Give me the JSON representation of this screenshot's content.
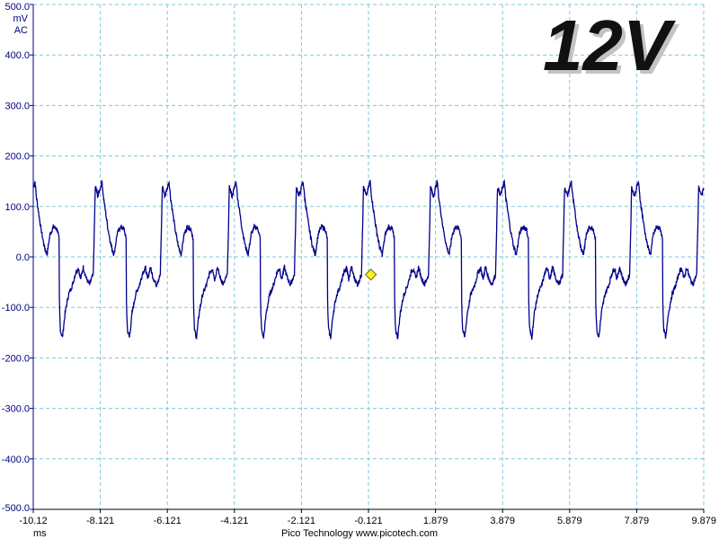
{
  "chart_data": {
    "type": "line",
    "y_unit": "mV",
    "coupling": "AC",
    "x_unit": "ms",
    "annotation": "12V",
    "credit": "Pico Technology  www.picotech.com",
    "grid": true,
    "xlim": [
      -10.121,
      9.879
    ],
    "ylim": [
      -500,
      500
    ],
    "y_ticks": [
      500,
      400,
      300,
      200,
      100,
      0,
      -100,
      -200,
      -300,
      -400,
      -500
    ],
    "y_tick_labels": [
      "500.0",
      "400.0",
      "300.0",
      "200.0",
      "100.0",
      "0.0",
      "-100.0",
      "-200.0",
      "-300.0",
      "-400.0",
      "-500.0"
    ],
    "x_ticks": [
      -10.121,
      -8.121,
      -6.121,
      -4.121,
      -2.121,
      -0.121,
      1.879,
      3.879,
      5.879,
      7.879,
      9.879
    ],
    "x_tick_labels": [
      "-10.12",
      "-8.121",
      "-6.121",
      "-4.121",
      "-2.121",
      "-0.121",
      "1.879",
      "3.879",
      "5.879",
      "7.879",
      "9.879"
    ],
    "trigger_marker": {
      "x": -0.05,
      "y": -35
    },
    "period_ms": 2.0,
    "cycle_start_ms": -10.07,
    "cycle_shape": [
      [
        0.0,
        150
      ],
      [
        0.04,
        120
      ],
      [
        0.18,
        55
      ],
      [
        0.28,
        20
      ],
      [
        0.36,
        5
      ],
      [
        0.45,
        45
      ],
      [
        0.55,
        60
      ],
      [
        0.66,
        55
      ],
      [
        0.72,
        35
      ],
      [
        0.73,
        -100
      ],
      [
        0.76,
        -145
      ],
      [
        0.82,
        -160
      ],
      [
        0.9,
        -110
      ],
      [
        1.0,
        -75
      ],
      [
        1.12,
        -55
      ],
      [
        1.22,
        -30
      ],
      [
        1.3,
        -22
      ],
      [
        1.36,
        -45
      ],
      [
        1.44,
        -20
      ],
      [
        1.52,
        -40
      ],
      [
        1.62,
        -55
      ],
      [
        1.74,
        -35
      ],
      [
        1.8,
        140
      ],
      [
        1.88,
        120
      ],
      [
        2.0,
        150
      ]
    ],
    "series_color": "#00008b",
    "grid_color": "#7ec8d8",
    "annotation_color": "#111111"
  }
}
